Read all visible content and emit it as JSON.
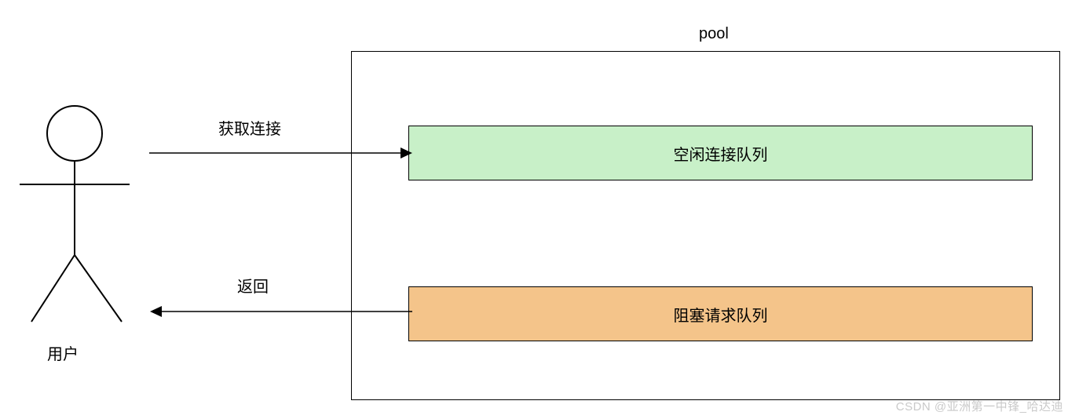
{
  "diagram": {
    "user_label": "用户",
    "pool_label": "pool",
    "idle_queue_label": "空闲连接队列",
    "block_queue_label": "阻塞请求队列",
    "arrow_get_label": "获取连接",
    "arrow_return_label": "返回",
    "watermark": "CSDN @亚洲第一中锋_哈达迪"
  }
}
